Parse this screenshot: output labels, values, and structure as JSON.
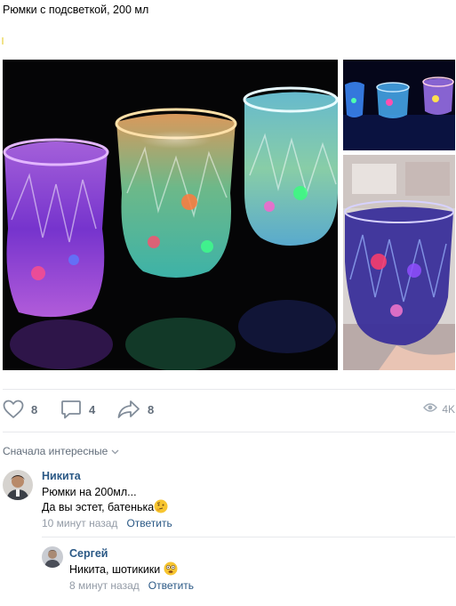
{
  "post": {
    "text": "Рюмки с подсветкой, 200 мл"
  },
  "actions": {
    "likes": "8",
    "comments": "4",
    "shares": "8",
    "views": "4K"
  },
  "comments_sort": {
    "label": "Сначала интересные"
  },
  "comments": [
    {
      "author": "Никита",
      "line1": "Рюмки на 200мл...",
      "line2": "Да вы эстет, батенька",
      "time": "10 минут назад",
      "reply": "Ответить"
    },
    {
      "author": "Сергей",
      "line1": "Никита, шотикики",
      "time": "8 минут назад",
      "reply": "Ответить"
    }
  ],
  "colors": {
    "link": "#2a5885",
    "muted": "#939ba6",
    "action": "#626d7a",
    "divider": "#e7e8ec"
  }
}
